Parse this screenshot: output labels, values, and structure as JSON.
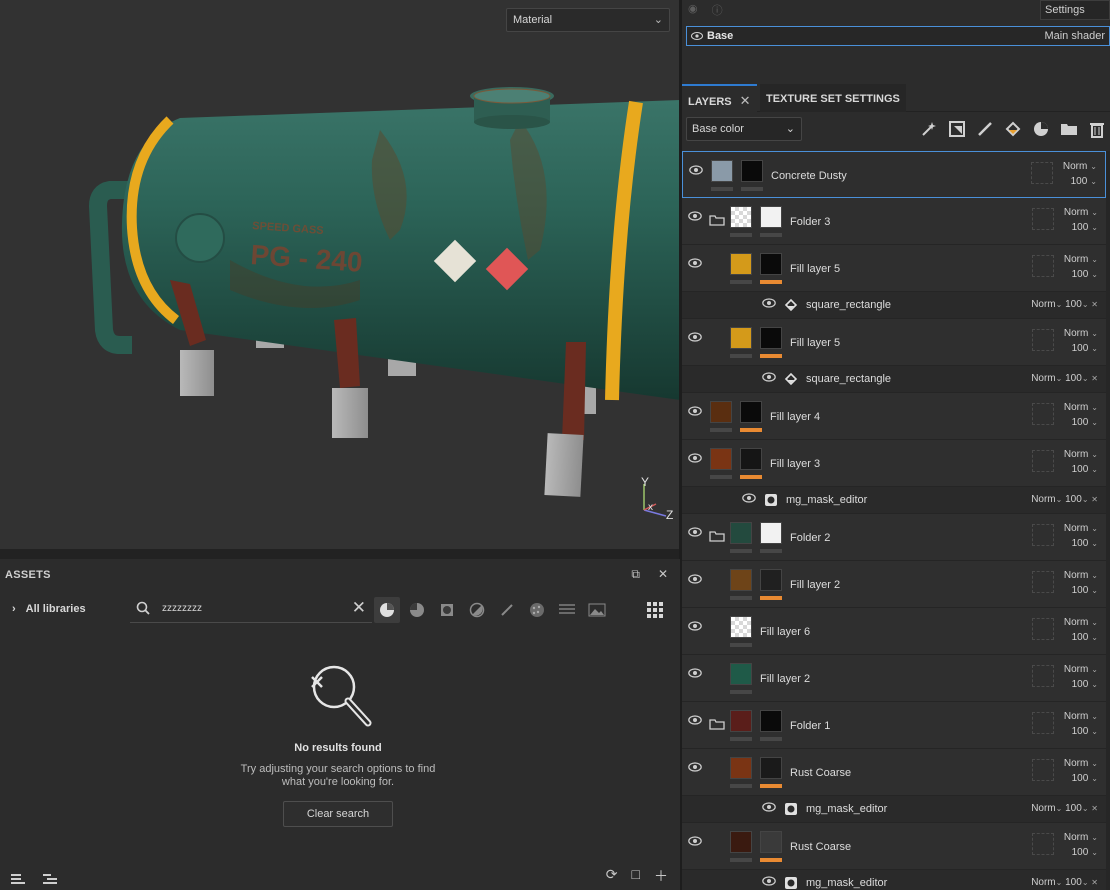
{
  "viewport": {
    "material_select": "Material",
    "tank_text_small": "SPEED GASS",
    "tank_text_big": "PG - 240",
    "axis_labels": {
      "x": "x",
      "y": "Y",
      "z": "Z"
    }
  },
  "assets": {
    "title": "ASSETS",
    "libraries_label": "All libraries",
    "search_value": "zzzzzzzz",
    "empty_title": "No results found",
    "empty_desc_line1": "Try adjusting your search options to find",
    "empty_desc_line2": "what you're looking for.",
    "clear_button": "Clear search"
  },
  "shaders": {
    "settings_label": "Settings",
    "base_name": "Base",
    "base_shader": "Main shader"
  },
  "tabs": {
    "layers": "LAYERS",
    "texture_set_settings": "TEXTURE SET SETTINGS"
  },
  "channel": "Base color",
  "layers": [
    {
      "name": "Concrete Dusty",
      "blend": "Norm",
      "opacity": "100",
      "selected": true,
      "folder": false,
      "thumb": "#8a9aa8",
      "mask": "#0a0a0a",
      "orange": false
    },
    {
      "name": "Folder 3",
      "blend": "Norm",
      "opacity": "100",
      "folder": true,
      "thumb": "checker",
      "mask": "#f2f2f2",
      "orange": false
    },
    {
      "name": "Fill layer 5",
      "blend": "Norm",
      "opacity": "100",
      "folder": false,
      "thumb": "#d49a1a",
      "mask": "#0a0a0a",
      "orange": true,
      "indent": true
    },
    {
      "sub": true,
      "name": "square_rectangle",
      "blend": "Norm",
      "opacity": "100",
      "icon": "fill"
    },
    {
      "name": "Fill layer 5",
      "blend": "Norm",
      "opacity": "100",
      "folder": false,
      "thumb": "#d49a1a",
      "mask": "#0a0a0a",
      "orange": true,
      "indent": true
    },
    {
      "sub": true,
      "name": "square_rectangle",
      "blend": "Norm",
      "opacity": "100",
      "icon": "fill"
    },
    {
      "name": "Fill layer 4",
      "blend": "Norm",
      "opacity": "100",
      "folder": false,
      "thumb": "#5a2e10",
      "mask": "#0a0a0a",
      "orange": true
    },
    {
      "name": "Fill layer 3",
      "blend": "Norm",
      "opacity": "100",
      "folder": false,
      "thumb": "#7a3414",
      "mask": "#151515",
      "orange": true
    },
    {
      "sub": true,
      "name": "mg_mask_editor",
      "blend": "Norm",
      "opacity": "100",
      "icon": "mask",
      "deep": false
    },
    {
      "name": "Folder 2",
      "blend": "Norm",
      "opacity": "100",
      "folder": true,
      "thumb": "#234a3e",
      "mask": "#f2f2f2",
      "orange": false
    },
    {
      "name": "Fill layer 2",
      "blend": "Norm",
      "opacity": "100",
      "folder": false,
      "thumb": "#6e4418",
      "mask": "#202020",
      "orange": true,
      "indent": true
    },
    {
      "name": "Fill layer 6",
      "blend": "Norm",
      "opacity": "100",
      "folder": false,
      "thumb": "checker",
      "mask": null,
      "orange": false,
      "indent": true
    },
    {
      "name": "Fill layer 2",
      "blend": "Norm",
      "opacity": "100",
      "folder": false,
      "thumb": "#1f5a48",
      "mask": null,
      "orange": false,
      "indent": true
    },
    {
      "name": "Folder 1",
      "blend": "Norm",
      "opacity": "100",
      "folder": true,
      "thumb": "#5a1e1a",
      "mask": "#0a0a0a",
      "orange": false
    },
    {
      "name": "Rust Coarse",
      "blend": "Norm",
      "opacity": "100",
      "folder": false,
      "thumb": "#7a3414",
      "mask": "#1a1a1a",
      "orange": true,
      "indent": true
    },
    {
      "sub": true,
      "name": "mg_mask_editor",
      "blend": "Norm",
      "opacity": "100",
      "icon": "mask",
      "deep": true
    },
    {
      "name": "Rust Coarse",
      "blend": "Norm",
      "opacity": "100",
      "folder": false,
      "thumb": "#3a1a10",
      "mask": "#3a3a3a",
      "orange": true,
      "indent": true
    },
    {
      "sub": true,
      "name": "mg_mask_editor",
      "blend": "Norm",
      "opacity": "100",
      "icon": "mask",
      "deep": true
    }
  ]
}
